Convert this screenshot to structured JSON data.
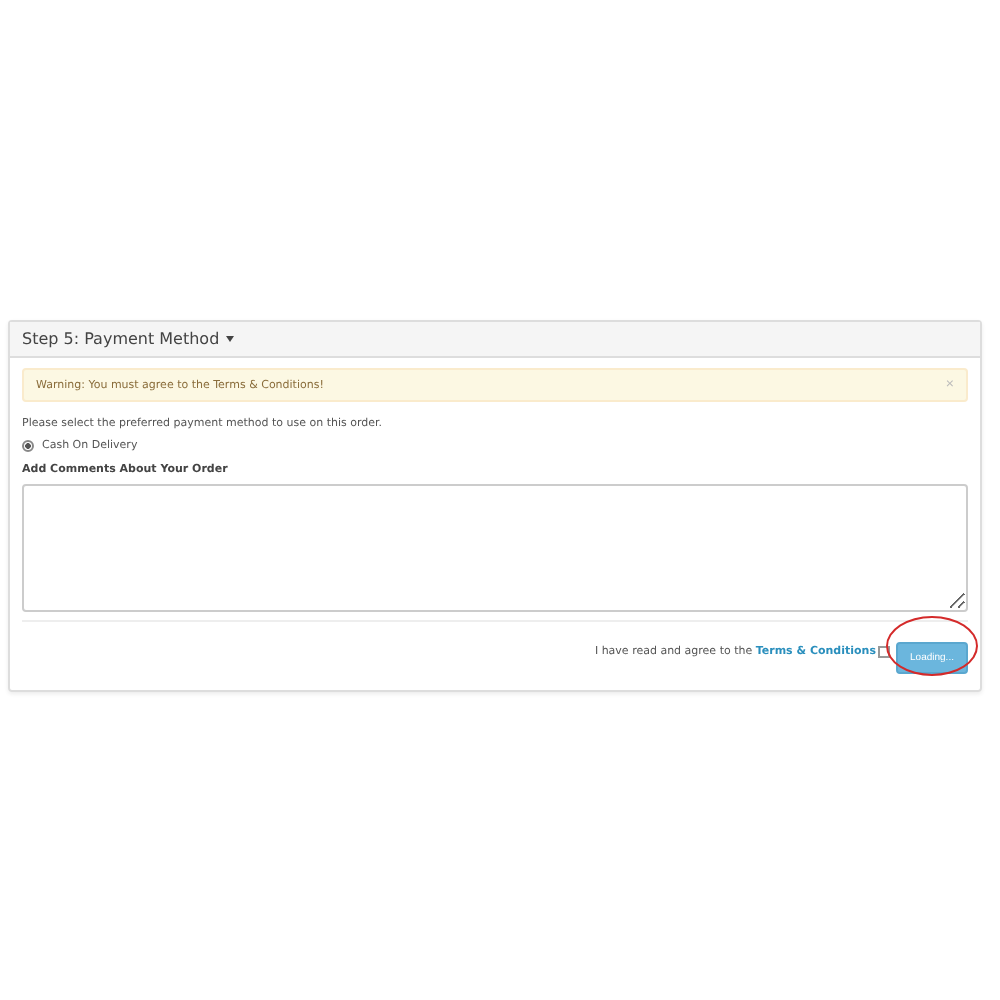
{
  "panel": {
    "title": "Step 5: Payment Method",
    "expanded": true
  },
  "alert": {
    "text": "Warning: You must agree to the Terms & Conditions!",
    "close": "×"
  },
  "intro": "Please select the preferred payment method to use on this order.",
  "methods": [
    {
      "label": "Cash On Delivery",
      "selected": true
    }
  ],
  "comments": {
    "label": "Add Comments About Your Order"
  },
  "agree": {
    "text": "I have read and agree to the ",
    "link": "Terms & Conditions",
    "checked": false
  },
  "button": {
    "label": "Loading...",
    "highlighted": true
  }
}
